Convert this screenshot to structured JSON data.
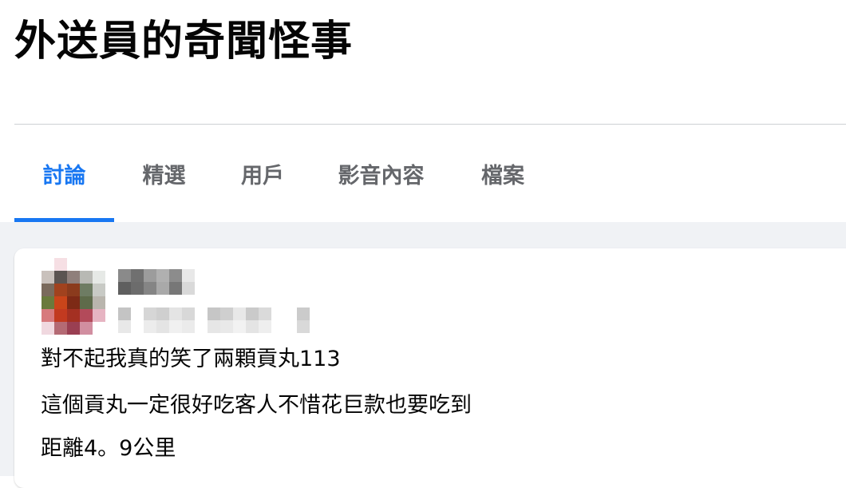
{
  "group": {
    "title": "外送員的奇聞怪事"
  },
  "tabs": [
    {
      "label": "討論",
      "active": true
    },
    {
      "label": "精選",
      "active": false
    },
    {
      "label": "用戶",
      "active": false
    },
    {
      "label": "影音內容",
      "active": false
    },
    {
      "label": "檔案",
      "active": false
    }
  ],
  "post": {
    "author_name": "",
    "meta": "",
    "lines": [
      "對不起我真的笑了兩顆貢丸113",
      "這個貢丸一定很好吃客人不惜花巨款也要吃到",
      "距離4。9公里"
    ]
  },
  "colors": {
    "accent": "#1877f2",
    "tab_inactive": "#65676b",
    "feed_background": "#f0f2f5",
    "divider": "#ced0d4"
  }
}
